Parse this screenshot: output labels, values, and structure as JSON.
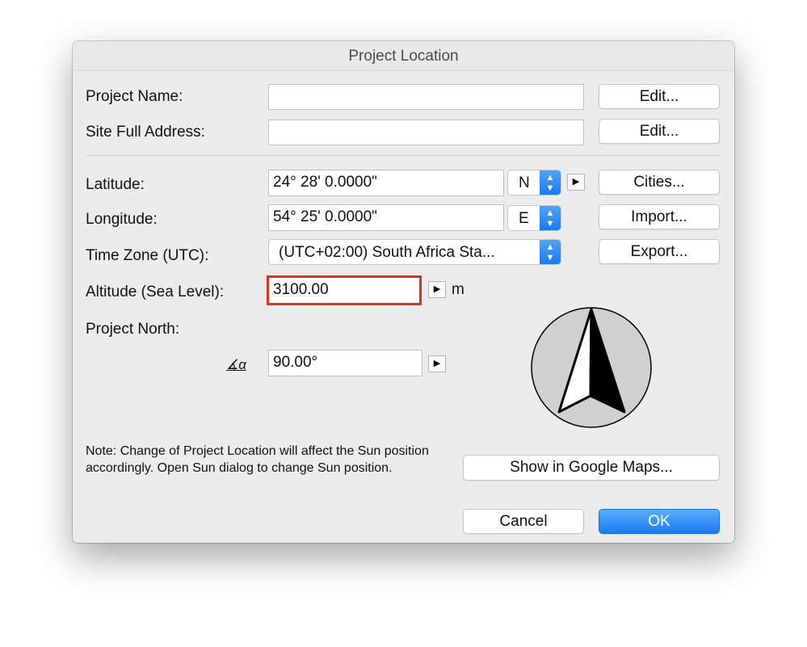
{
  "dialog": {
    "title": "Project Location"
  },
  "project_name": {
    "label": "Project Name:",
    "value": "",
    "edit": "Edit..."
  },
  "site_address": {
    "label": "Site Full Address:",
    "value": "",
    "edit": "Edit..."
  },
  "latitude": {
    "label": "Latitude:",
    "value": "24° 28' 0.0000\"",
    "hemisphere": "N"
  },
  "longitude": {
    "label": "Longitude:",
    "value": "54° 25' 0.0000\"",
    "hemisphere": "E"
  },
  "timezone": {
    "label": "Time Zone (UTC):",
    "value": "(UTC+02:00) South Africa Sta..."
  },
  "altitude": {
    "label": "Altitude (Sea Level):",
    "value": "3100.00",
    "unit": "m",
    "highlight_color": "#e0301e"
  },
  "project_north": {
    "label": "Project North:",
    "angle_symbol": "∡α",
    "value": "90.00°"
  },
  "buttons": {
    "cities": "Cities...",
    "import": "Import...",
    "export": "Export...",
    "google_maps": "Show in Google Maps...",
    "cancel": "Cancel",
    "ok": "OK"
  },
  "note": "Note: Change of Project Location will affect the Sun position accordingly. Open Sun dialog to change Sun position.",
  "colors": {
    "accent": "#1a7bf0"
  }
}
